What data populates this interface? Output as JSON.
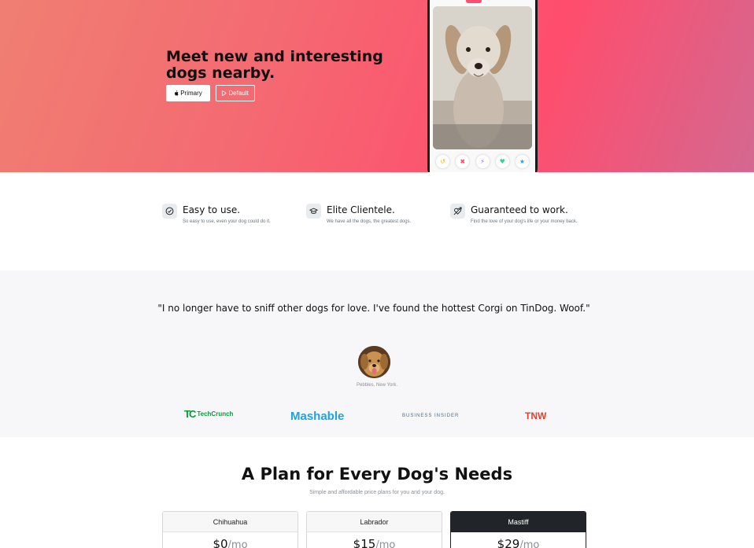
{
  "hero": {
    "title": "Meet new and interesting dogs nearby.",
    "primary_button": "Primary",
    "default_button": "Default",
    "phone_actions": [
      "undo-icon",
      "close-icon",
      "bolt-icon",
      "heart-icon",
      "star-icon"
    ]
  },
  "features": [
    {
      "icon": "check-circle-icon",
      "title": "Easy to use.",
      "desc": "So easy to use, even your dog could do it."
    },
    {
      "icon": "graduation-cap-icon",
      "title": "Elite Clientele.",
      "desc": "We have all the dogs, the greatest dogs."
    },
    {
      "icon": "heart-arrow-icon",
      "title": "Guaranteed to work.",
      "desc": "Find the love of your dog's life or your money back."
    }
  ],
  "testimonial": {
    "quote": "\"I no longer have to sniff other dogs for love. I've found the hottest Corgi on TinDog. Woof.\"",
    "caption": "Pebbles, New York.",
    "logos": {
      "techcrunch_mark": "TC",
      "techcrunch": "TechCrunch",
      "mashable": "Mashable",
      "business_insider": "BUSINESS INSIDER",
      "tnw": "TNW"
    }
  },
  "pricing": {
    "title": "A Plan for Every Dog's Needs",
    "subtitle": "Simple and affordable price plans for you and your dog.",
    "plans": [
      {
        "name": "Chihuahua",
        "price": "$0",
        "period": "/mo"
      },
      {
        "name": "Labrador",
        "price": "$15",
        "period": "/mo"
      },
      {
        "name": "Mastiff",
        "price": "$29",
        "period": "/mo"
      }
    ]
  },
  "colors": {
    "hero_gradient_start": "#f07f72",
    "hero_gradient_end": "#ff4d6d",
    "dark_card": "#212529",
    "techcrunch": "#0a9a3a",
    "mashable": "#1fa3e0",
    "tnw": "#e2402b"
  }
}
